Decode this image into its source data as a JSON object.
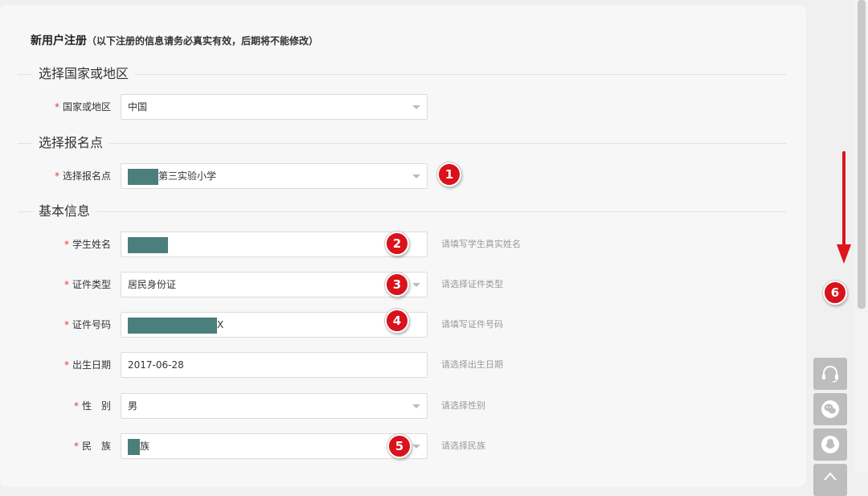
{
  "form": {
    "title": "新用户注册",
    "subtitle": "（以下注册的信息请务必真实有效，后期将不能修改）"
  },
  "sections": {
    "country": "选择国家或地区",
    "site": "选择报名点",
    "basic": "基本信息"
  },
  "required_mark": "*",
  "fields": {
    "country": {
      "label": "国家或地区",
      "value": "中国",
      "hint": ""
    },
    "site": {
      "label": "选择报名点",
      "value": "第三实验小学",
      "hint": ""
    },
    "name": {
      "label": "学生姓名",
      "value": "",
      "hint": "请填写学生真实姓名"
    },
    "id_type": {
      "label": "证件类型",
      "value": "居民身份证",
      "hint": "请选择证件类型"
    },
    "id_number": {
      "label": "证件号码",
      "value": "X",
      "hint": "请填写证件号码"
    },
    "birth": {
      "label": "出生日期",
      "value": "2017-06-28",
      "hint": "请选择出生日期"
    },
    "gender": {
      "label": "性　别",
      "value": "男",
      "hint": "请选择性别"
    },
    "ethnicity": {
      "label": "民　族",
      "value": "族",
      "hint": "请选择民族"
    }
  },
  "annotations": [
    "1",
    "2",
    "3",
    "4",
    "5",
    "6"
  ],
  "colors": {
    "badge": "#d9121b",
    "arrow": "#e0141b",
    "required": "#e4393c",
    "mask": "#4a7f7c"
  },
  "toolbar": {
    "icons": [
      "headset-icon",
      "wechat-icon",
      "qq-icon",
      "back-to-top-icon"
    ]
  }
}
